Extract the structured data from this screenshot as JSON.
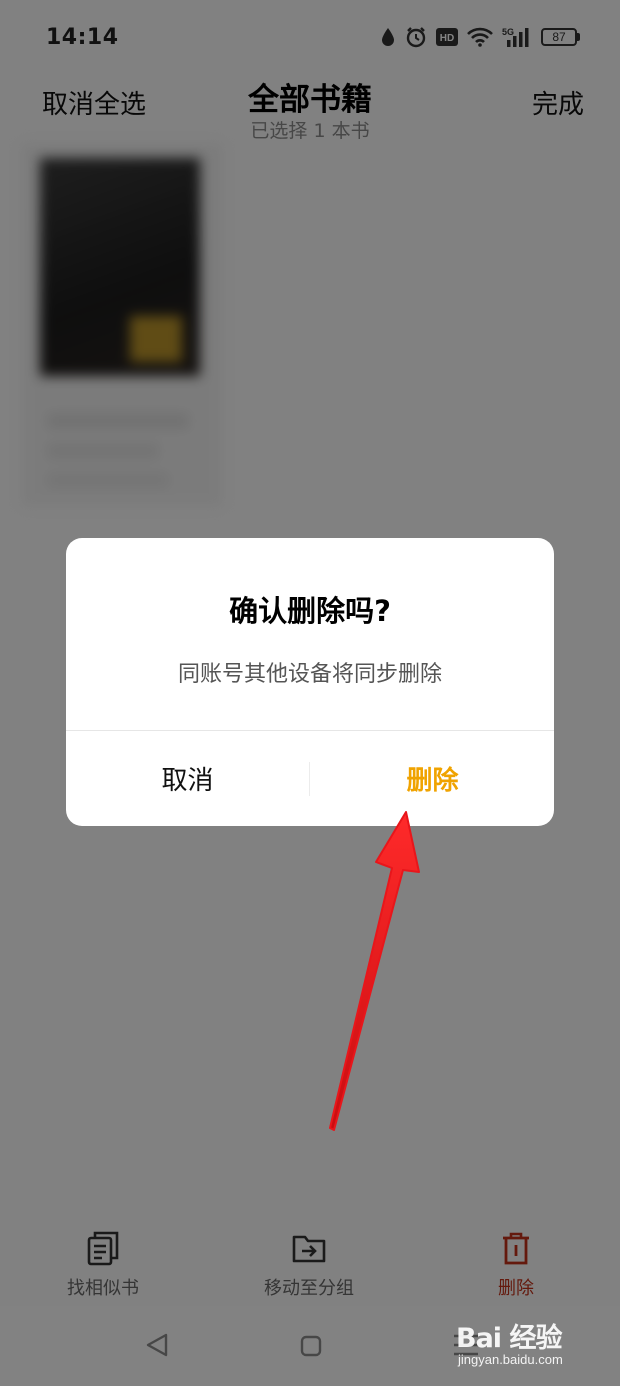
{
  "status_bar": {
    "time": "14:14",
    "network": "5G",
    "hd": "HD",
    "battery": "87",
    "icons": [
      "water-drop-icon",
      "alarm-icon",
      "hd-icon",
      "wifi-icon",
      "signal-icon",
      "battery-icon"
    ]
  },
  "header": {
    "cancel_all": "取消全选",
    "title": "全部书籍",
    "subtitle": "已选择 1 本书",
    "done": "完成"
  },
  "toolbar": {
    "items": [
      {
        "label": "找相似书",
        "icon": "similar-books-icon"
      },
      {
        "label": "移动至分组",
        "icon": "move-to-folder-icon"
      },
      {
        "label": "删除",
        "icon": "trash-icon"
      }
    ]
  },
  "dialog": {
    "title": "确认删除吗?",
    "message": "同账号其他设备将同步删除",
    "cancel": "取消",
    "confirm": "删除"
  },
  "nav_bar": {
    "icons": [
      "back-triangle-icon",
      "home-square-icon",
      "menu-lines-icon"
    ]
  },
  "watermark": {
    "logo": "Bai 经验",
    "url": "jingyan.baidu.com"
  },
  "colors": {
    "accent": "#f0a300",
    "danger": "#c0311a",
    "annotation_arrow": "#e8161b",
    "overlay": "rgba(0,0,0,0.48)"
  }
}
